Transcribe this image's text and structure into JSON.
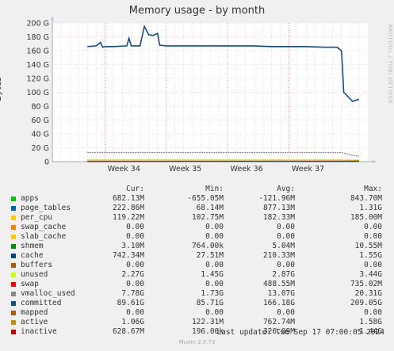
{
  "chart_data": {
    "type": "line",
    "title": "Memory usage - by month",
    "ylabel": "Bytes",
    "yunit": "G",
    "ylim": [
      0,
      200
    ],
    "yticks": [
      0,
      20,
      40,
      60,
      80,
      100,
      120,
      140,
      160,
      180,
      200
    ],
    "ytick_labels": [
      "0",
      "20 G",
      "40 G",
      "60 G",
      "80 G",
      "100 G",
      "120 G",
      "140 G",
      "160 G",
      "180 G",
      "200 G"
    ],
    "xlim": [
      "2024-08-13",
      "2024-09-18"
    ],
    "xticks": [
      {
        "label": "Week 34",
        "date": "2024-08-19"
      },
      {
        "label": "Week 35",
        "date": "2024-08-26"
      },
      {
        "label": "Week 36",
        "date": "2024-09-02"
      },
      {
        "label": "Week 37",
        "date": "2024-09-09"
      }
    ],
    "watermark": "RRDTOOL / TOBI OETIKER",
    "series": [
      {
        "name": "committed",
        "color": "#0e4e8c",
        "points": [
          [
            "2024-08-17",
            166
          ],
          [
            "2024-08-18",
            167
          ],
          [
            "2024-08-18 12:00",
            172
          ],
          [
            "2024-08-18 18:00",
            165
          ],
          [
            "2024-08-19",
            166
          ],
          [
            "2024-08-20",
            166
          ],
          [
            "2024-08-21 12:00",
            167
          ],
          [
            "2024-08-21 18:00",
            178
          ],
          [
            "2024-08-22",
            167
          ],
          [
            "2024-08-22 12:00",
            167
          ],
          [
            "2024-08-23",
            167
          ],
          [
            "2024-08-23 12:00",
            195
          ],
          [
            "2024-08-24",
            183
          ],
          [
            "2024-08-24 12:00",
            182
          ],
          [
            "2024-08-25",
            185
          ],
          [
            "2024-08-25 06:00",
            168
          ],
          [
            "2024-08-26",
            167
          ],
          [
            "2024-08-28",
            167
          ],
          [
            "2024-08-30",
            167
          ],
          [
            "2024-09-01",
            167
          ],
          [
            "2024-09-03",
            167
          ],
          [
            "2024-09-05",
            167
          ],
          [
            "2024-09-07",
            166
          ],
          [
            "2024-09-09",
            166
          ],
          [
            "2024-09-11",
            166
          ],
          [
            "2024-09-13",
            165
          ],
          [
            "2024-09-14 12:00",
            165
          ],
          [
            "2024-09-15",
            160
          ],
          [
            "2024-09-15 06:00",
            100
          ],
          [
            "2024-09-16 06:00",
            87
          ],
          [
            "2024-09-16 18:00",
            89
          ],
          [
            "2024-09-17",
            90
          ]
        ]
      },
      {
        "name": "vmalloc_used",
        "color": "#888888",
        "points": [
          [
            "2024-08-17",
            13.1
          ],
          [
            "2024-09-15",
            13.1
          ],
          [
            "2024-09-16 06:00",
            9.0
          ],
          [
            "2024-09-17",
            7.8
          ]
        ]
      },
      {
        "name": "unused",
        "color": "#ccff00",
        "points": [
          [
            "2024-08-17",
            3.0
          ],
          [
            "2024-09-15",
            3.0
          ],
          [
            "2024-09-16 06:00",
            2.5
          ],
          [
            "2024-09-17",
            2.3
          ]
        ]
      },
      {
        "name": "cache",
        "color": "#0066b3",
        "points": [
          [
            "2024-08-17",
            0.2
          ],
          [
            "2024-09-17",
            0.74
          ]
        ]
      },
      {
        "name": "page_tables",
        "color": "#0066b3",
        "points": [
          [
            "2024-08-17",
            0.9
          ],
          [
            "2024-09-17",
            0.22
          ]
        ]
      },
      {
        "name": "active",
        "color": "#c09000",
        "points": [
          [
            "2024-08-17",
            1.0
          ],
          [
            "2024-09-17",
            1.06
          ]
        ]
      },
      {
        "name": "inactive",
        "color": "#cc0000",
        "points": [
          [
            "2024-08-17",
            0.3
          ],
          [
            "2024-09-17",
            0.63
          ]
        ]
      }
    ]
  },
  "legend": {
    "headers": [
      "Cur:",
      "Min:",
      "Avg:",
      "Max:"
    ],
    "rows": [
      {
        "name": "apps",
        "color": "#00cc00",
        "cur": "682.13M",
        "min": "-655.05M",
        "avg": "-121.96M",
        "max": "843.70M"
      },
      {
        "name": "page_tables",
        "color": "#0066b3",
        "cur": "222.86M",
        "min": "68.14M",
        "avg": "877.13M",
        "max": "1.31G"
      },
      {
        "name": "per_cpu",
        "color": "#ffcc00",
        "cur": "119.22M",
        "min": "102.75M",
        "avg": "182.33M",
        "max": "185.00M"
      },
      {
        "name": "swap_cache",
        "color": "#ff8000",
        "cur": "0.00",
        "min": "0.00",
        "avg": "0.00",
        "max": "0.00"
      },
      {
        "name": "slab_cache",
        "color": "#ffcc00",
        "cur": "0.00",
        "min": "0.00",
        "avg": "0.00",
        "max": "0.00"
      },
      {
        "name": "shmem",
        "color": "#008f00",
        "cur": "3.10M",
        "min": "764.00k",
        "avg": "5.04M",
        "max": "10.55M"
      },
      {
        "name": "cache",
        "color": "#00487d",
        "cur": "742.34M",
        "min": "27.51M",
        "avg": "210.33M",
        "max": "1.55G"
      },
      {
        "name": "buffers",
        "color": "#b35a00",
        "cur": "0.00",
        "min": "0.00",
        "avg": "0.00",
        "max": "0.00"
      },
      {
        "name": "unused",
        "color": "#ccff00",
        "cur": "2.27G",
        "min": "1.45G",
        "avg": "2.87G",
        "max": "3.44G"
      },
      {
        "name": "swap",
        "color": "#ff0000",
        "cur": "0.00",
        "min": "0.00",
        "avg": "488.55M",
        "max": "735.02M"
      },
      {
        "name": "vmalloc_used",
        "color": "#888888",
        "cur": "7.78G",
        "min": "1.73G",
        "avg": "13.07G",
        "max": "20.31G"
      },
      {
        "name": "committed",
        "color": "#0e4e8c",
        "cur": "89.61G",
        "min": "85.71G",
        "avg": "166.18G",
        "max": "209.05G"
      },
      {
        "name": "mapped",
        "color": "#b35a00",
        "cur": "0.00",
        "min": "0.00",
        "avg": "0.00",
        "max": "0.00"
      },
      {
        "name": "active",
        "color": "#c09000",
        "cur": "1.06G",
        "min": "122.31M",
        "avg": "762.74M",
        "max": "1.58G"
      },
      {
        "name": "inactive",
        "color": "#cc0000",
        "cur": "628.67M",
        "min": "196.00k",
        "avg": "326.09M",
        "max": "1.44G"
      }
    ]
  },
  "last_update": "Last update: Tue Sep 17 07:00:05 2024",
  "footer": "Munin 2.0.73"
}
